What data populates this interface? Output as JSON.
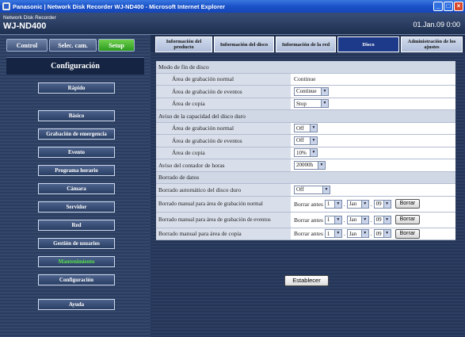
{
  "window": {
    "title": "Panasonic | Network Disk Recorder WJ-ND400 - Microsoft Internet Explorer"
  },
  "header": {
    "subtitle": "Network Disk Recorder",
    "model": "WJ-ND400",
    "clock": "01.Jan.09  0:00"
  },
  "mode_tabs": [
    "Control",
    "Selec. cam.",
    "Setup"
  ],
  "sidebar": {
    "heading": "Configuración",
    "items": [
      "Rápido",
      "Básico",
      "Grabación de emergencia",
      "Evento",
      "Programa horario",
      "Cámara",
      "Servidor",
      "Red",
      "Gestión de usuarios",
      "Mantenimiento",
      "Configuración",
      "Ayuda"
    ]
  },
  "tabs": [
    "Información del producto",
    "Información del disco",
    "Información de la red",
    "Disco",
    "Administración de los ajustes"
  ],
  "form": {
    "sec1": "Modo de fin de disco",
    "f1_label": "Área de grabación normal",
    "f1_value": "Continue",
    "f2_label": "Área de grabación de eventos",
    "f2_value": "Continue",
    "f3_label": "Área de copia",
    "f3_value": "Stop",
    "sec2": "Aviso de la capacidad del disco duro",
    "f4_label": "Área de grabación normal",
    "f4_value": "Off",
    "f5_label": "Área de grabación de eventos",
    "f5_value": "Off",
    "f6_label": "Área de copia",
    "f6_value": "10%",
    "f7_label": "Aviso del contador de horas",
    "f7_value": "20000h",
    "sec3": "Borrado de datos",
    "f8_label": "Borrado automático del disco duro",
    "f8_value": "Off",
    "f9_label": "Borrado manual para área de grabación normal",
    "f10_label": "Borrado manual para área de grabación de eventos",
    "f11_label": "Borrado manual para área de copia",
    "borrar_antes": "Borrar antes",
    "day": "1",
    "month": "Jan",
    "year": "09",
    "borrar": "Borrar",
    "establecer": "Establecer"
  }
}
